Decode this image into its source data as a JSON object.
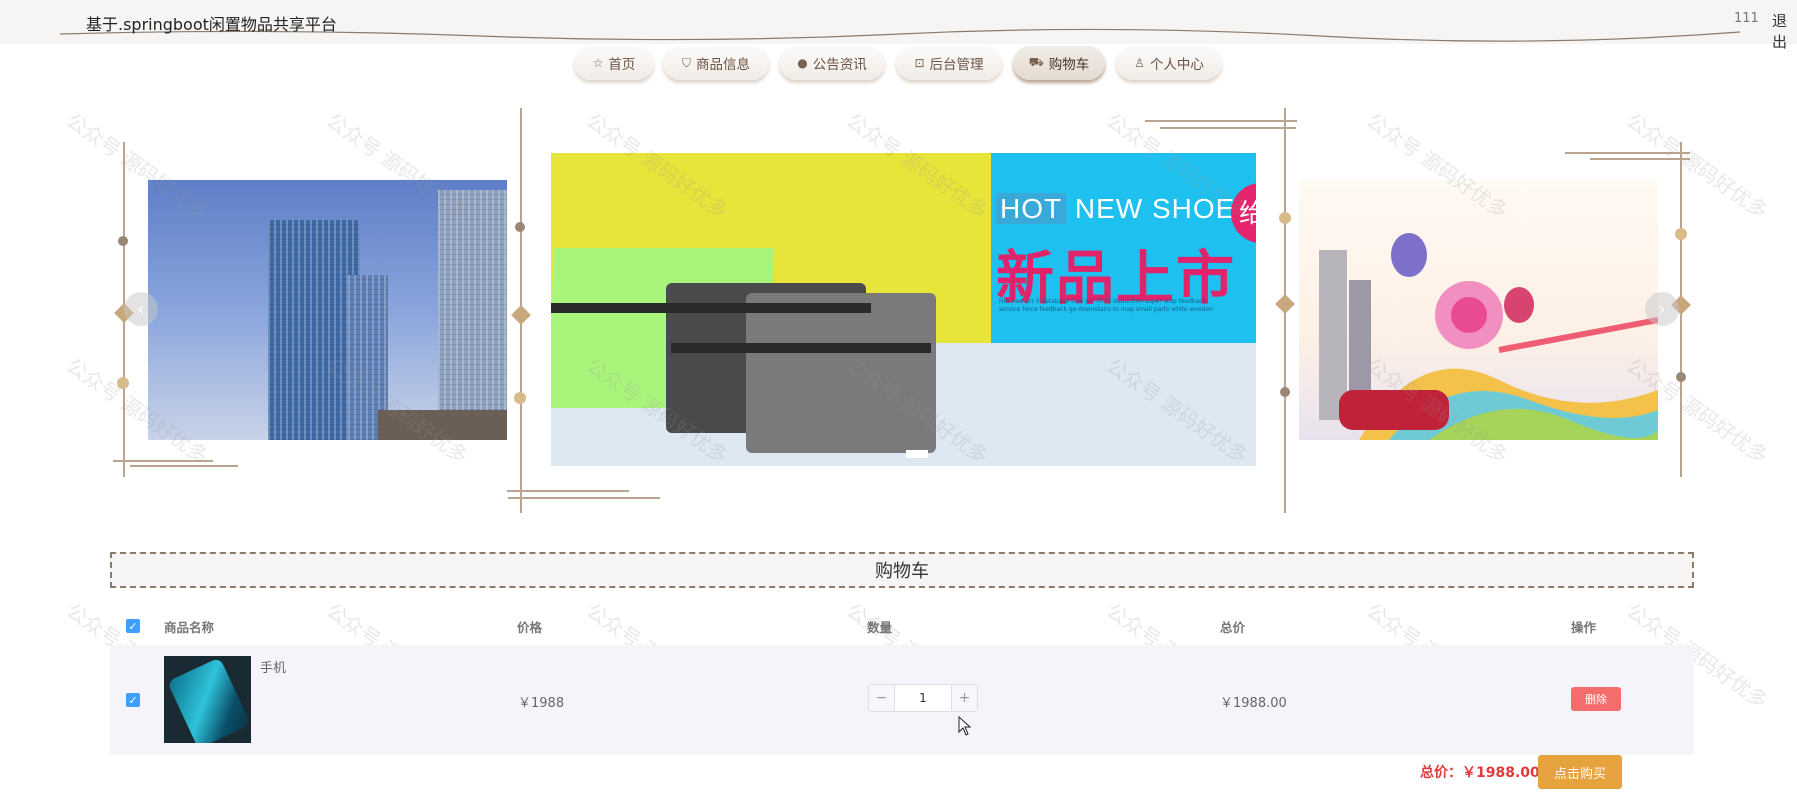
{
  "header": {
    "title": "基于.springboot闲置物品共享平台",
    "user": "111",
    "logout": "退出"
  },
  "nav": {
    "items": [
      {
        "label": "首页",
        "icon": "star-icon"
      },
      {
        "label": "商品信息",
        "icon": "bag-icon"
      },
      {
        "label": "公告资讯",
        "icon": "info-icon"
      },
      {
        "label": "后台管理",
        "icon": "briefcase-icon"
      },
      {
        "label": "购物车",
        "icon": "cart-icon"
      },
      {
        "label": "个人中心",
        "icon": "user-icon"
      }
    ],
    "active": "购物车"
  },
  "banner": {
    "hot": "HOT",
    "new_shoes": "NEW SHOES",
    "headline": "新品上市",
    "badge": "给",
    "fine_print": "Hot new arr il database Live Jun fri-fri deduction super stop feedback service force feedback go downstairs to map small parts white wooden"
  },
  "watermark": "公众号 源码好优多",
  "cart": {
    "title": "购物车",
    "columns": [
      "商品名称",
      "价格",
      "数量",
      "总价",
      "操作"
    ],
    "rows": [
      {
        "name": "手机",
        "price": "￥1988",
        "quantity": "1",
        "subtotal": "￥1988.00",
        "action": "删除"
      }
    ],
    "total_label": "总价：￥1988.00",
    "buy_label": "点击购买"
  },
  "colors": {
    "accent_brown": "#8c7a6b",
    "primary_blue": "#409eff",
    "danger": "#f56c6c",
    "warning": "#e6a23c",
    "total_red": "#e03a3a"
  }
}
